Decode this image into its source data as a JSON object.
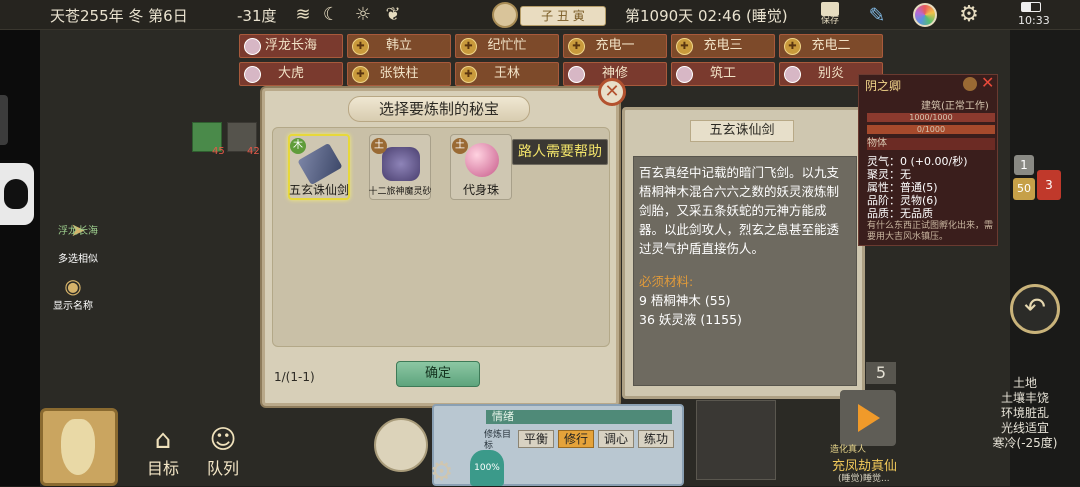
{
  "topbar": {
    "date": "天苍255年 冬 第6日",
    "temperature": "-31度",
    "season_badge": "子 丑 寅",
    "day_time": "第1090天 02:46 (睡觉)",
    "save_label": "保存",
    "clock": "10:33"
  },
  "tabs": [
    {
      "label": "浮龙长海",
      "type": "user"
    },
    {
      "label": "韩立",
      "type": "gold"
    },
    {
      "label": "纪忙忙",
      "type": "gold"
    },
    {
      "label": "充电一",
      "type": "gold"
    },
    {
      "label": "充电三",
      "type": "gold"
    },
    {
      "label": "充电二",
      "type": "gold"
    },
    {
      "label": "大虎",
      "type": "user"
    },
    {
      "label": "张铁柱",
      "type": "gold"
    },
    {
      "label": "王林",
      "type": "gold"
    },
    {
      "label": "神修",
      "type": "user"
    },
    {
      "label": "筑工",
      "type": "user"
    },
    {
      "label": "别炎",
      "type": "user"
    }
  ],
  "dialog": {
    "title": "选择要炼制的秘宝",
    "items": [
      {
        "name": "五玄诛仙剑",
        "element": "木",
        "element_color": "#5f9c3a",
        "selected": true
      },
      {
        "name": "十二旅神魔灵砂",
        "element": "土",
        "element_color": "#9a6a34",
        "selected": false
      },
      {
        "name": "代身珠",
        "element": "土",
        "element_color": "#9a6a34",
        "selected": false
      }
    ],
    "help_button": "路人需要帮助",
    "page": "1/(1-1)",
    "ok_button": "确定"
  },
  "description": {
    "title": "五玄诛仙剑",
    "body": "百玄真经中记载的暗门飞剑。以九支梧桐神木混合六六之数的妖灵液炼制剑胎，又采五条妖蛇的元神方能成器。以此剑攻人，烈玄之息甚至能透过灵气护盾直接伤人。",
    "materials_title": "必须材料:",
    "materials": [
      "9 梧桐神木 (55)",
      "36 妖灵液 (1155)"
    ]
  },
  "info_panel": {
    "name": "阴之卿",
    "subtitle": "建筑(正常工作)",
    "bar1": "1000/1000",
    "bar2": "0/1000",
    "section": "物体",
    "rows": [
      "灵气：0 (+0.00/秒)",
      "聚灵：无",
      "属性：普通(5)",
      "品阶：灵物(6)",
      "品质：无品质"
    ],
    "note": "有什么东西正试图孵化出来，需要用大吉风水镇压。"
  },
  "left": {
    "item1": "浮龙长海",
    "item1_sub": "多选相似",
    "item2": "显示名称",
    "badge1": "45",
    "badge2": "42"
  },
  "bottom": {
    "target": "目标",
    "queue": "队列",
    "mood": "情绪",
    "modes": [
      "平衡",
      "修行",
      "调心",
      "练功"
    ],
    "mode_label": "修炼目标",
    "percent": "100%",
    "action": "充凤劫真仙",
    "action_sub": "(睡觉)睡觉...",
    "action_top": "造化真人",
    "speed": "5"
  },
  "badges": {
    "b1": "1",
    "b2": "50",
    "b3": "3"
  },
  "terrain": [
    "土地",
    "土壤丰饶",
    "环境脏乱",
    "光线适宜",
    "寒冷(-25度)"
  ]
}
